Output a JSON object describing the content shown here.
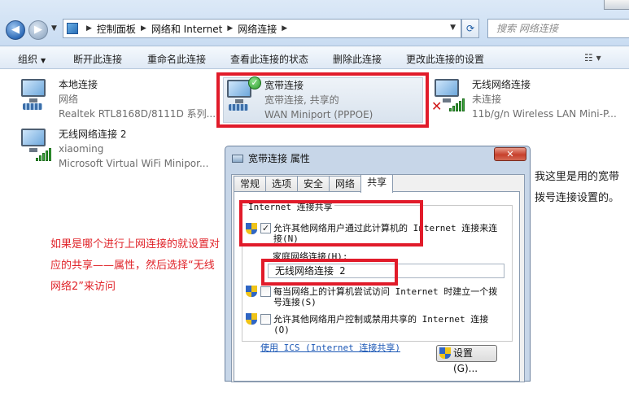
{
  "address_bar": {
    "breadcrumbs": [
      "控制面板",
      "网络和 Internet",
      "网络连接"
    ],
    "search_placeholder": "搜索 网络连接"
  },
  "command_bar": {
    "organize": "组织",
    "items": [
      "断开此连接",
      "重命名此连接",
      "查看此连接的状态",
      "删除此连接",
      "更改此连接的设置"
    ]
  },
  "connections": [
    {
      "name": "本地连接",
      "status": "网络",
      "device": "Realtek RTL8168D/8111D 系列..."
    },
    {
      "name": "宽带连接",
      "status": "宽带连接, 共享的",
      "device": "WAN Miniport (PPPOE)"
    },
    {
      "name": "无线网络连接",
      "status": "未连接",
      "device": "11b/g/n  Wireless LAN Mini-P..."
    },
    {
      "name": "无线网络连接 2",
      "status": "xiaoming",
      "device": "Microsoft Virtual WiFi Minipor..."
    }
  ],
  "dialog": {
    "title": "宽带连接 属性",
    "tabs": [
      "常规",
      "选项",
      "安全",
      "网络",
      "共享"
    ],
    "group_title": "Internet 连接共享",
    "option1": "允许其他网络用户通过此计算机的 Internet 连接来连接(N)",
    "home_network_label": "家庭网络连接(H):",
    "home_network_value": "无线网络连接 2",
    "option2": "每当网络上的计算机尝试访问 Internet 时建立一个拨号连接(S)",
    "option3": "允许其他网络用户控制或禁用共享的 Internet 连接(O)",
    "ics_link": "使用 ICS (Internet 连接共享)",
    "settings_button": "设置(G)..."
  },
  "annotations": {
    "left": "如果是哪个进行上网连接的就设置对应的共享——属性，然后选择“无线网络2”来访问",
    "right": "我这里是用的宽带拨号连接设置的。"
  }
}
